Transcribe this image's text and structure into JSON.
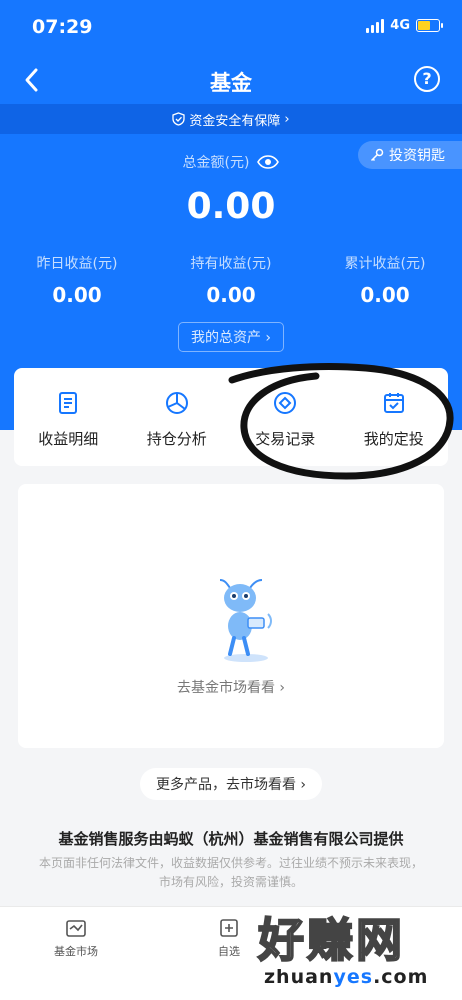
{
  "status_bar": {
    "time": "07:29",
    "network": "4G"
  },
  "nav": {
    "back_icon": "chevron-left-icon",
    "title": "基金",
    "help_icon": "question-circle-icon",
    "help_glyph": "?"
  },
  "safety": {
    "label": "资金安全有保障",
    "arrow": "›"
  },
  "invest_key": {
    "label": "投资钥匙"
  },
  "summary": {
    "total_label": "总金额(元)",
    "total_value": "0.00",
    "stats": [
      {
        "label": "昨日收益(元)",
        "value": "0.00"
      },
      {
        "label": "持有收益(元)",
        "value": "0.00"
      },
      {
        "label": "累计收益(元)",
        "value": "0.00"
      }
    ],
    "assets_button": "我的总资产 ›"
  },
  "actions": [
    {
      "label": "收益明细",
      "icon": "document-icon"
    },
    {
      "label": "持仓分析",
      "icon": "pie-chart-icon"
    },
    {
      "label": "交易记录",
      "icon": "transaction-icon"
    },
    {
      "label": "我的定投",
      "icon": "calendar-check-icon"
    }
  ],
  "empty_state": {
    "link": "去基金市场看看 ›",
    "illustration": "ant-mascot-icon"
  },
  "more_button": "更多产品，去市场看看 ›",
  "footer": {
    "provider": "基金销售服务由蚂蚁（杭州）基金销售有限公司提供",
    "disclaimer_line1": "本页面非任何法律文件，收益数据仅供参考。过往业绩不预示未来表现，",
    "disclaimer_line2": "市场有风险，投资需谨慎。"
  },
  "tabs": [
    {
      "label": "基金市场",
      "icon": "market-icon"
    },
    {
      "label": "自选",
      "icon": "watchlist-icon"
    }
  ],
  "watermark": {
    "cn": "好赚网",
    "en_a": "zhuan",
    "en_b": "yes",
    "en_c": ".com"
  },
  "colors": {
    "primary": "#1677ff",
    "safety_strip": "#0f64e6",
    "background": "#f4f5f7"
  }
}
